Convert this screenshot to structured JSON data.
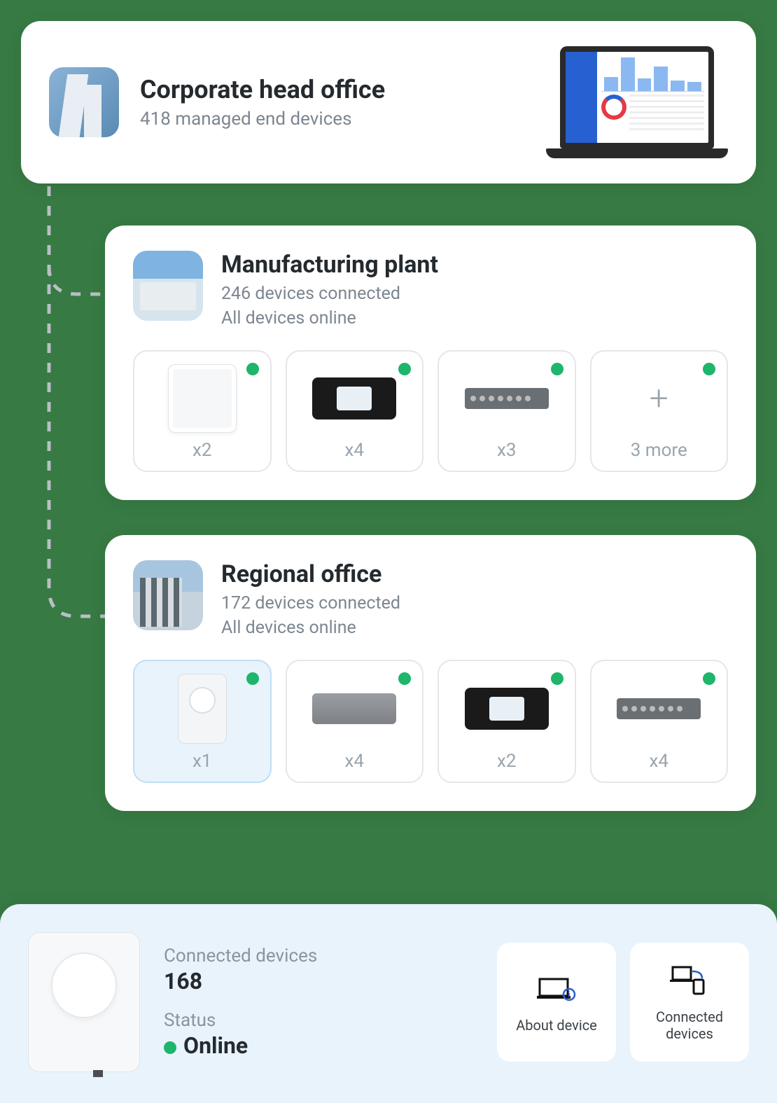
{
  "colors": {
    "online": "#1db66a",
    "accent_blue": "#2760d0"
  },
  "head": {
    "title": "Corporate head office",
    "subtitle": "418 managed end devices"
  },
  "sites": [
    {
      "title": "Manufacturing plant",
      "sub1": "246 devices connected",
      "sub2": "All devices online",
      "devices": [
        {
          "type": "ap-square",
          "count": "x2"
        },
        {
          "type": "router-black",
          "count": "x4"
        },
        {
          "type": "switch",
          "count": "x3"
        },
        {
          "type": "more",
          "count": "3 more"
        }
      ]
    },
    {
      "title": "Regional office",
      "sub1": "172 devices connected",
      "sub2": "All devices online",
      "devices": [
        {
          "type": "cpe",
          "count": "x1",
          "selected": true
        },
        {
          "type": "gw-box",
          "count": "x4"
        },
        {
          "type": "router-black",
          "count": "x2"
        },
        {
          "type": "switch",
          "count": "x4"
        }
      ]
    }
  ],
  "detail": {
    "connected_label": "Connected devices",
    "connected_value": "168",
    "status_label": "Status",
    "status_value": "Online",
    "actions": {
      "about": "About device",
      "connected": "Connected devices"
    }
  }
}
